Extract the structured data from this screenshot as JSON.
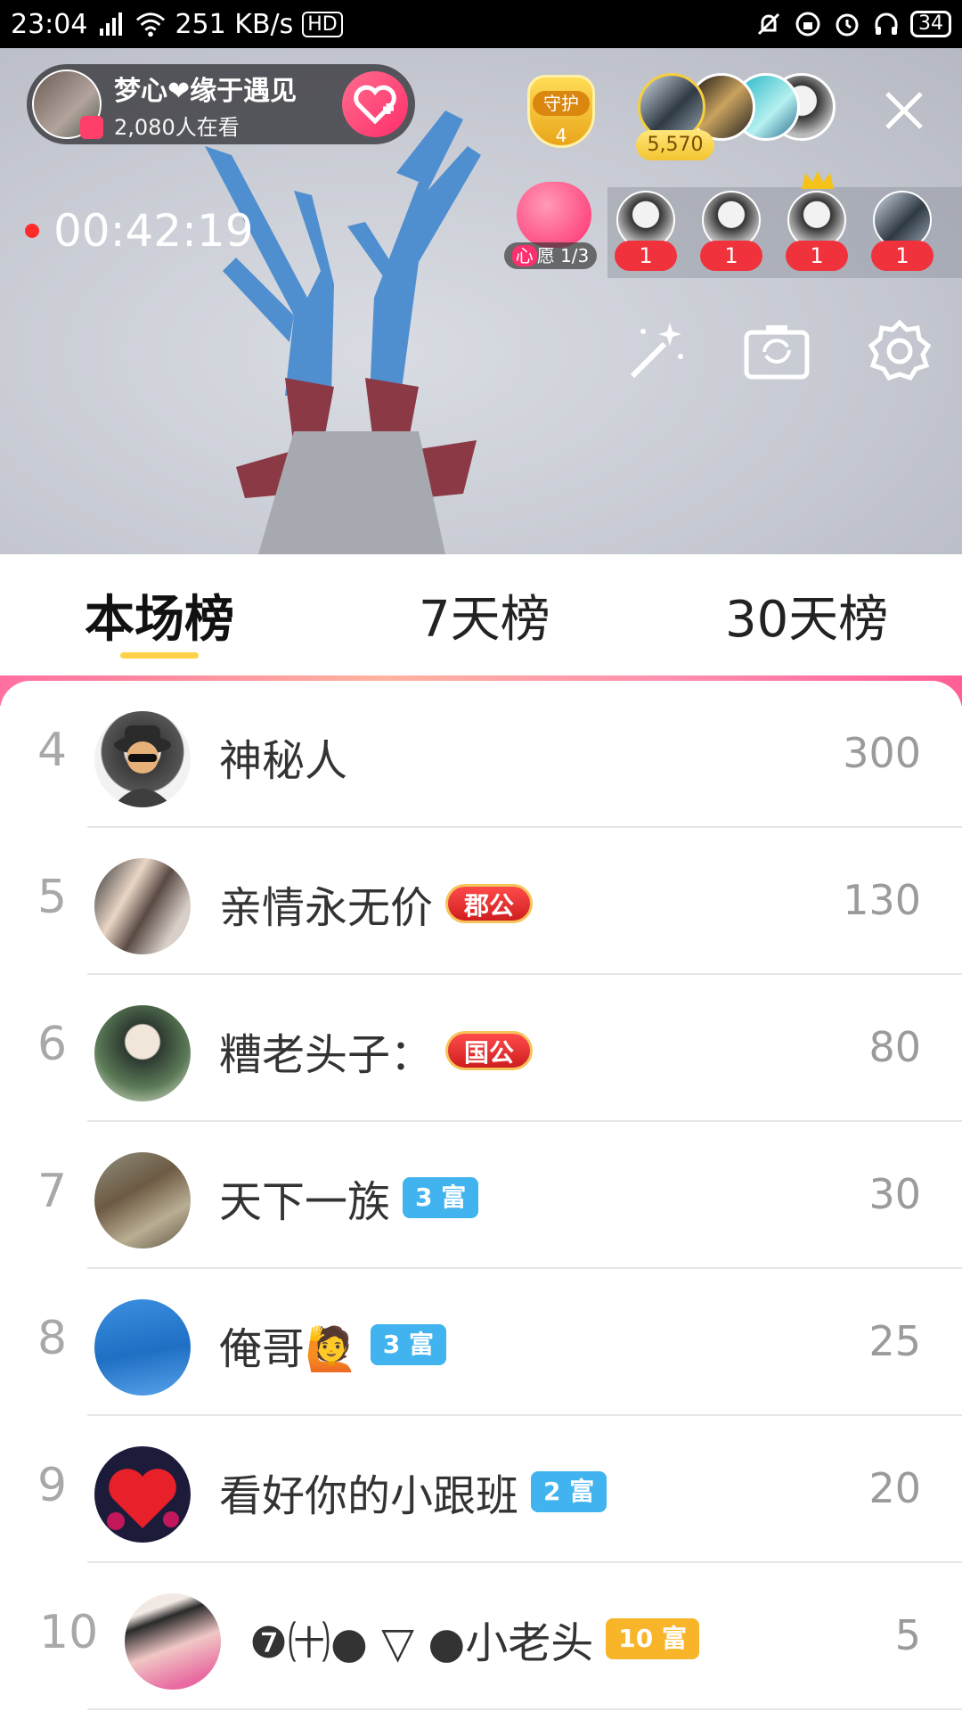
{
  "statusbar": {
    "time": "23:04",
    "network": "4G",
    "speed": "251 KB/s",
    "hd": "HD",
    "battery": "34"
  },
  "host": {
    "name": "梦心❤缘于遇见",
    "viewers": "2,080人在看"
  },
  "guard": {
    "label": "守护",
    "count": "4"
  },
  "top_viewer_badge": "5,570",
  "timer": "00:42:19",
  "wish": {
    "prefix": "心",
    "label": "愿 1/3"
  },
  "gift_counts": [
    "1",
    "1",
    "1",
    "1"
  ],
  "tabs": [
    "本场榜",
    "7天榜",
    "30天榜"
  ],
  "active_tab": "本场榜",
  "colors": {
    "accent_pink": "#ff2f6a",
    "tab_underline": "#ffd24a",
    "rich_badge": "#41b3ee",
    "rich_badge_gold": "#f8b52a"
  },
  "leaderboard": [
    {
      "rank": "4",
      "name": "神秘人",
      "badge": "",
      "score": "300"
    },
    {
      "rank": "5",
      "name": "亲情永无价",
      "badge": "郡公",
      "score": "130"
    },
    {
      "rank": "6",
      "name": "糟老头子：",
      "badge": "国公",
      "score": "80"
    },
    {
      "rank": "7",
      "name": "天下一族",
      "badge": "3 富",
      "score": "30"
    },
    {
      "rank": "8",
      "name": "俺哥🙋",
      "badge": "3 富",
      "score": "25"
    },
    {
      "rank": "9",
      "name": "看好你的小跟班",
      "badge": "2 富",
      "score": "20"
    },
    {
      "rank": "10",
      "name": "❼㈩● ▽ ●小老头",
      "badge": "10 富",
      "score": "5"
    }
  ]
}
